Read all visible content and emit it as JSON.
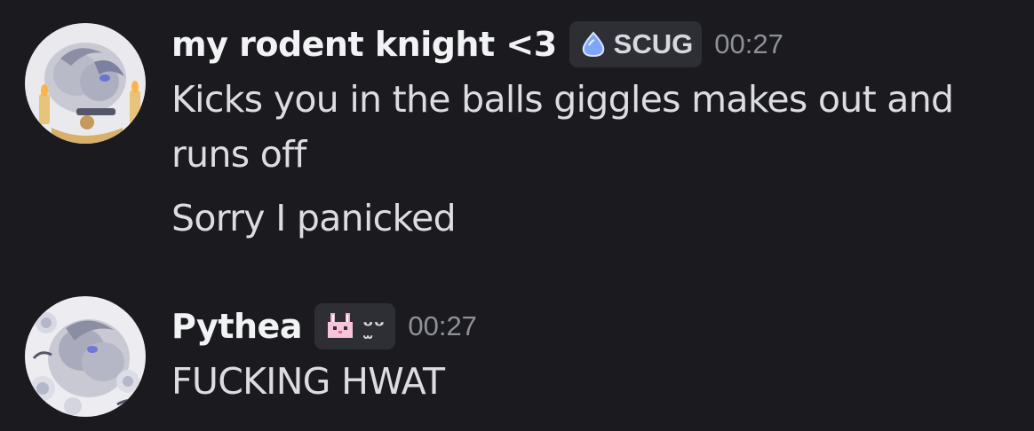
{
  "messages": [
    {
      "author": "my rodent knight <3",
      "tag": {
        "icon": "blue-drop-icon",
        "label": "SCUG"
      },
      "time": "00:27",
      "lines": [
        "Kicks you in the balls giggles makes out and",
        "runs off",
        "Sorry I panicked"
      ],
      "avatar": "avatar-candles-kiss"
    },
    {
      "author": "Pythea",
      "tag": {
        "icon": "pink-bunny-icon",
        "label": "ᵕ̫ᵕ"
      },
      "time": "00:27",
      "lines": [
        "FUCKING HWAT"
      ],
      "avatar": "avatar-roses-kiss"
    }
  ],
  "colors": {
    "background": "#1b1b1f",
    "username": "#f2f3f5",
    "body_text": "#dcdde1",
    "timestamp": "#8e9199",
    "tag_bg": "#2e2f35",
    "drop_blue": "#7ea6ff",
    "bunny_pink": "#f5a9c8"
  }
}
